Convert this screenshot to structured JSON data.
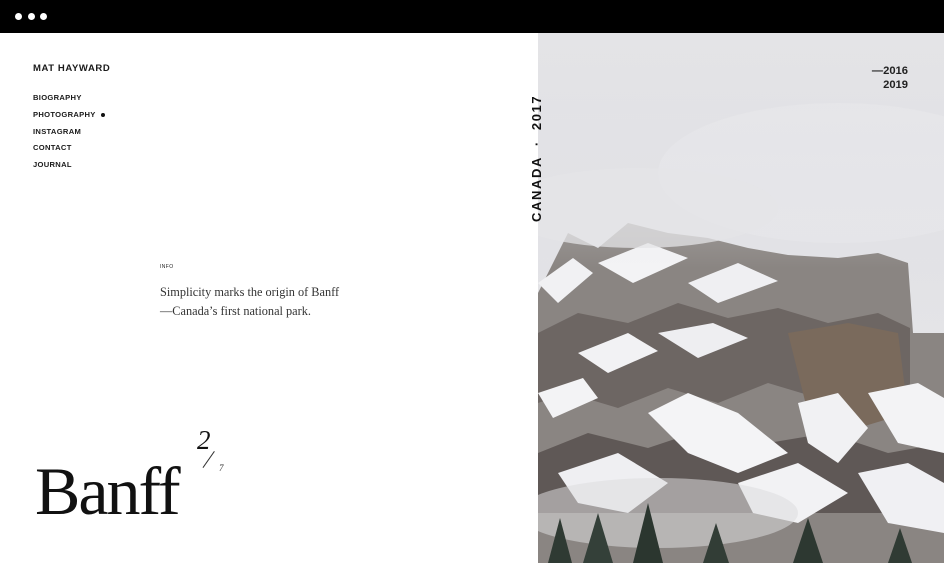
{
  "window": {
    "controls": [
      "dot",
      "dot",
      "dot"
    ]
  },
  "brand": "MAT HAYWARD",
  "nav": {
    "items": [
      {
        "label": "BIOGRAPHY",
        "active": false
      },
      {
        "label": "PHOTOGRAPHY",
        "active": true
      },
      {
        "label": "INSTAGRAM",
        "active": false
      },
      {
        "label": "CONTACT",
        "active": false
      },
      {
        "label": "JOURNAL",
        "active": false
      }
    ]
  },
  "info": {
    "label": "INFO",
    "text_line1": "Simplicity marks the origin of Banff",
    "text_line2": "—Canada’s first national park."
  },
  "gallery": {
    "title": "Banff",
    "current": "2",
    "total": "7"
  },
  "photo": {
    "location": "CANADA",
    "year": "2017",
    "range_start": "—2016",
    "range_end": "2019"
  }
}
